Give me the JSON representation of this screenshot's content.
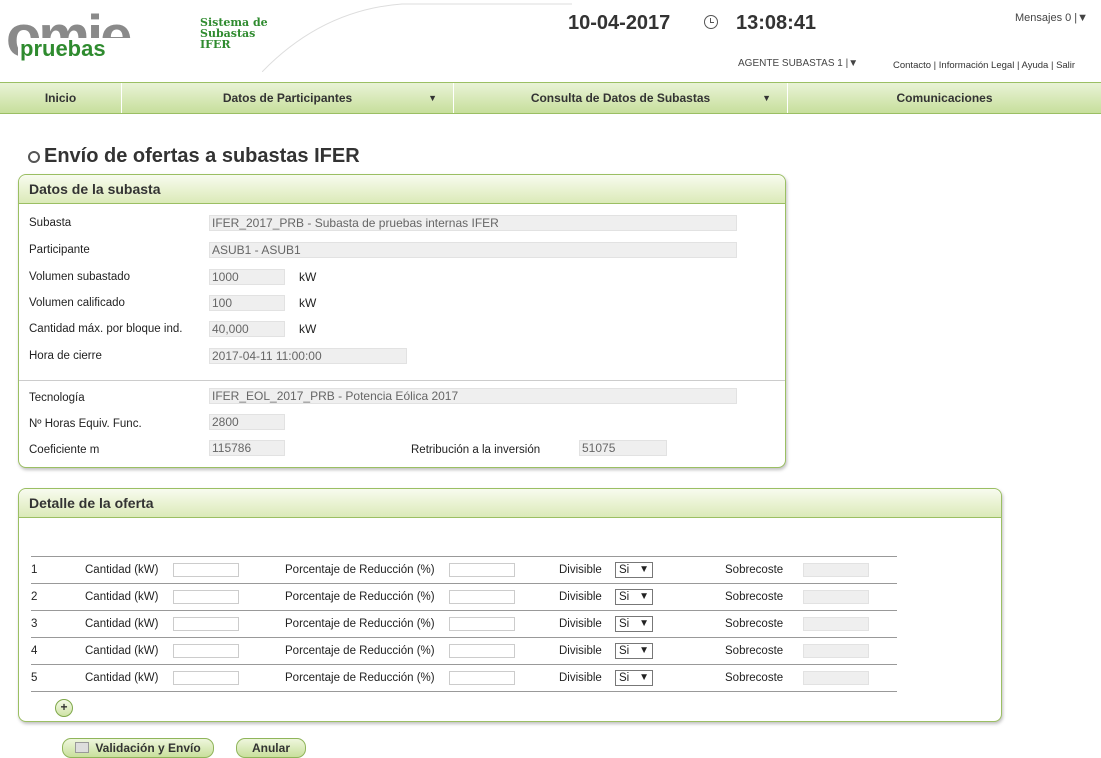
{
  "header": {
    "logo_text": "omie",
    "logo_sub": "pruebas",
    "system_name_lines": [
      "Sistema de",
      "Subastas",
      "IFER"
    ],
    "date": "10-04-2017",
    "time": "13:08:41",
    "messages": "Mensajes   0 |▼",
    "agent": "AGENTE SUBASTAS 1  |▼",
    "links": [
      "Contacto",
      "Información Legal",
      "Ayuda",
      "Salir"
    ],
    "link_sep": " | "
  },
  "nav": {
    "items": [
      {
        "label": "Inicio"
      },
      {
        "label": "Datos de Participantes",
        "arrow": "▼"
      },
      {
        "label": "Consulta de Datos de Subastas",
        "arrow": "▼"
      },
      {
        "label": "Comunicaciones"
      }
    ]
  },
  "page_title": "Envío de ofertas a subastas IFER",
  "auction": {
    "header": "Datos de la subasta",
    "subasta_label": "Subasta",
    "subasta_value": "IFER_2017_PRB - Subasta de pruebas internas IFER",
    "participante_label": "Participante",
    "participante_value": "ASUB1 - ASUB1",
    "vol_subastado_label": "Volumen subastado",
    "vol_subastado_value": "1000",
    "vol_calificado_label": "Volumen calificado",
    "vol_calificado_value": "100",
    "cant_max_label": "Cantidad máx. por bloque ind.",
    "cant_max_value": "40,000",
    "unit": "kW",
    "hora_cierre_label": "Hora de cierre",
    "hora_cierre_value": "2017-04-11 11:00:00",
    "tecnologia_label": "Tecnología",
    "tecnologia_value": "IFER_EOL_2017_PRB - Potencia Eólica 2017",
    "horas_label": "Nº Horas Equiv. Func.",
    "horas_value": "2800",
    "coef_label": "Coeficiente m",
    "coef_value": "115786",
    "retrib_label": "Retribución a la inversión",
    "retrib_value": "51075"
  },
  "offer": {
    "header": "Detalle de la oferta",
    "cantidad_label": "Cantidad (kW)",
    "porcentaje_label": "Porcentaje de Reducción (%)",
    "divisible_label": "Divisible",
    "divisible_value": "Si",
    "sobrecoste_label": "Sobrecoste",
    "rows": [
      {
        "n": "1"
      },
      {
        "n": "2"
      },
      {
        "n": "3"
      },
      {
        "n": "4"
      },
      {
        "n": "5"
      }
    ],
    "add_label": "+"
  },
  "buttons": {
    "submit": "Validación y Envío",
    "cancel": "Anular"
  },
  "colors": {
    "accent_green": "#2f8b2f",
    "nav_green": "#c7df9c",
    "border_green": "#9bbf63"
  }
}
